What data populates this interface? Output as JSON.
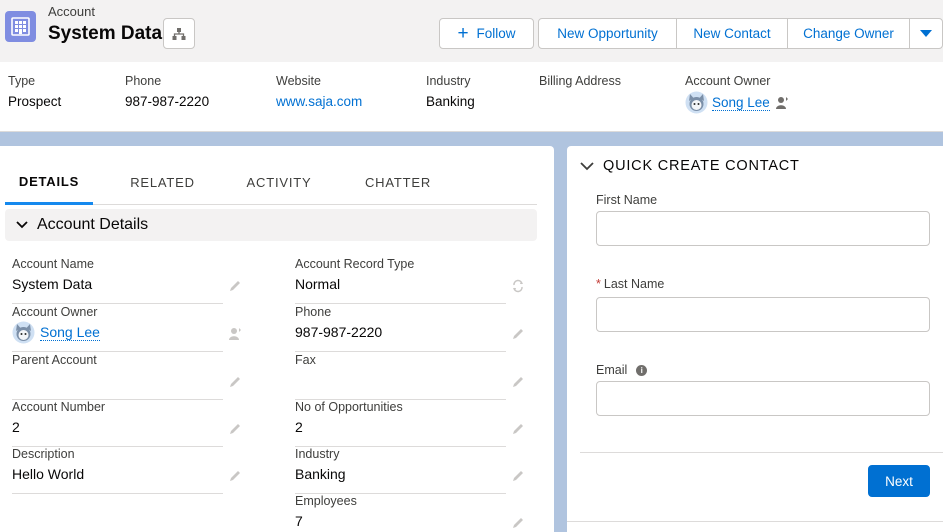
{
  "header": {
    "object_label": "Account",
    "title": "System Data",
    "actions": {
      "follow": "Follow",
      "new_opportunity": "New Opportunity",
      "new_contact": "New Contact",
      "change_owner": "Change Owner"
    }
  },
  "highlights": [
    {
      "label": "Type",
      "value": "Prospect"
    },
    {
      "label": "Phone",
      "value": "987-987-2220"
    },
    {
      "label": "Website",
      "value": "www.saja.com"
    },
    {
      "label": "Industry",
      "value": "Banking"
    },
    {
      "label": "Billing Address",
      "value": ""
    },
    {
      "label": "Account Owner",
      "value": "Song Lee"
    }
  ],
  "tabs": [
    "DETAILS",
    "RELATED",
    "ACTIVITY",
    "CHATTER"
  ],
  "details": {
    "section_title": "Account Details",
    "left": [
      {
        "label": "Account Name",
        "value": "System Data"
      },
      {
        "label": "Account Owner",
        "value": "Song Lee"
      },
      {
        "label": "Parent Account",
        "value": ""
      },
      {
        "label": "Account Number",
        "value": "2"
      },
      {
        "label": "Description",
        "value": "Hello World"
      }
    ],
    "right": [
      {
        "label": "Account Record Type",
        "value": "Normal"
      },
      {
        "label": "Phone",
        "value": "987-987-2220"
      },
      {
        "label": "Fax",
        "value": ""
      },
      {
        "label": "No of Opportunities",
        "value": "2"
      },
      {
        "label": "Industry",
        "value": "Banking"
      },
      {
        "label": "Employees",
        "value": "7"
      }
    ]
  },
  "quick_create": {
    "title": "QUICK CREATE CONTACT",
    "first_name_label": "First Name",
    "first_name_value": "",
    "required_marker": "*",
    "last_name_label": "Last Name",
    "last_name_value": "",
    "email_label": "Email",
    "email_value": "",
    "next_label": "Next"
  },
  "colors": {
    "brand_blue": "#0070d2",
    "account_icon": "#7f8de1",
    "page_background": "#b0c4df",
    "required_red": "#c23934"
  },
  "icons": {
    "account_icon": "account-icon",
    "hierarchy": "hierarchy-icon",
    "follow": "plus-icon",
    "more": "chevron-down-icon",
    "owner_change": "change-owner-icon",
    "edit": "pencil-icon",
    "section_toggle": "chevron-down-icon",
    "info": "info-icon"
  }
}
